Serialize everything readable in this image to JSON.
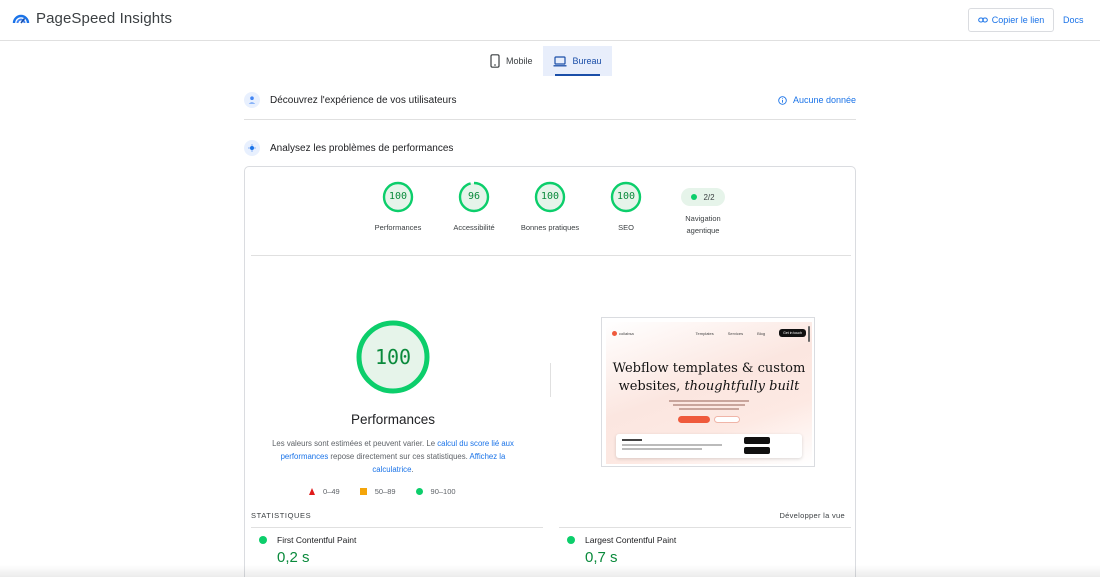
{
  "header": {
    "app_name": "PageSpeed Insights",
    "copy_link_label": "Copier le lien",
    "docs_label": "Docs"
  },
  "device_tabs": [
    {
      "label": "Mobile",
      "icon": "smartphone-icon",
      "active": false
    },
    {
      "label": "Bureau",
      "icon": "laptop-icon",
      "active": true
    }
  ],
  "field_data": {
    "title": "Découvrez l'expérience de vos utilisateurs",
    "status": "Aucune donnée"
  },
  "lab_data": {
    "title": "Analysez les problèmes de performances"
  },
  "scores": [
    {
      "label": "Performances",
      "value": "100"
    },
    {
      "label": "Accessibilité",
      "value": "96"
    },
    {
      "label": "Bonnes pratiques",
      "value": "100"
    },
    {
      "label": "SEO",
      "value": "100"
    }
  ],
  "agentic": {
    "value": "2/2",
    "label_line1": "Navigation",
    "label_line2": "agentique"
  },
  "main_score": {
    "value": "100",
    "title": "Performances"
  },
  "description": {
    "text1": "Les valeurs sont estimées et peuvent varier. Le ",
    "link1": "calcul du score lié aux performances",
    "text2": " repose directement sur ces statistiques. ",
    "link2": "Affichez la calculatrice",
    "text3": "."
  },
  "legend": {
    "fail": "0–49",
    "average": "50–89",
    "pass": "90–100"
  },
  "thumbnail": {
    "logo": "collabsa",
    "nav_links": [
      "Templates",
      "Services",
      "Blog"
    ],
    "nav_cta": "Get in touch",
    "headline_line1": "Webflow templates & custom",
    "headline_line2_plain": "websites, ",
    "headline_line2_italic": "thoughtfully built"
  },
  "statistics": {
    "heading": "STATISTIQUES",
    "expand_label": "Développer la vue",
    "metrics": [
      {
        "name": "First Contentful Paint",
        "value": "0,2 s"
      },
      {
        "name": "Largest Contentful Paint",
        "value": "0,7 s"
      }
    ]
  },
  "colors": {
    "pass": "#0cce6b",
    "average": "#f4a50a",
    "fail": "#e01b1b",
    "link": "#1a73e8"
  }
}
